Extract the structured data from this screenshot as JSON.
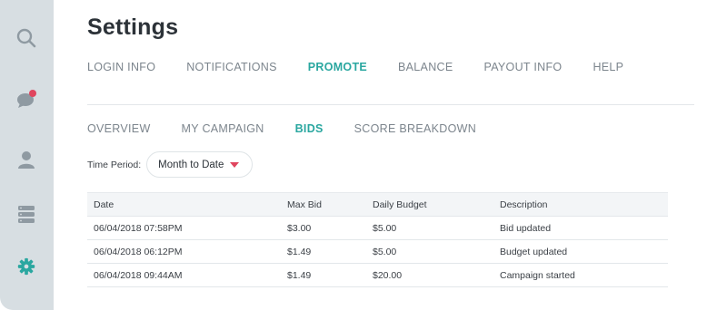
{
  "sidebar": {
    "icons": [
      "search-icon",
      "chat-icon",
      "user-icon",
      "server-icon",
      "gear-icon"
    ],
    "colors": {
      "background": "#d7dee2",
      "icon": "#8f9aa2",
      "active": "#2aa7a0",
      "notify": "#e0455e"
    }
  },
  "page": {
    "title": "Settings"
  },
  "top_tabs": [
    {
      "label": "LOGIN INFO",
      "active": false
    },
    {
      "label": "NOTIFICATIONS",
      "active": false
    },
    {
      "label": "PROMOTE",
      "active": true
    },
    {
      "label": "BALANCE",
      "active": false
    },
    {
      "label": "PAYOUT INFO",
      "active": false
    },
    {
      "label": "HELP",
      "active": false
    }
  ],
  "sub_tabs": [
    {
      "label": "OVERVIEW",
      "active": false
    },
    {
      "label": "MY CAMPAIGN",
      "active": false
    },
    {
      "label": "BIDS",
      "active": true
    },
    {
      "label": "SCORE BREAKDOWN",
      "active": false
    }
  ],
  "filter": {
    "label": "Time Period:",
    "value": "Month to Date"
  },
  "table": {
    "headers": [
      "Date",
      "Max Bid",
      "Daily Budget",
      "Description"
    ],
    "rows": [
      [
        "06/04/2018 07:58PM",
        "$3.00",
        "$5.00",
        "Bid updated"
      ],
      [
        "06/04/2018 06:12PM",
        "$1.49",
        "$5.00",
        "Budget updated"
      ],
      [
        "06/04/2018 09:44AM",
        "$1.49",
        "$20.00",
        "Campaign started"
      ]
    ]
  },
  "colors": {
    "accent": "#2aa7a0",
    "caret": "#e0455e"
  }
}
